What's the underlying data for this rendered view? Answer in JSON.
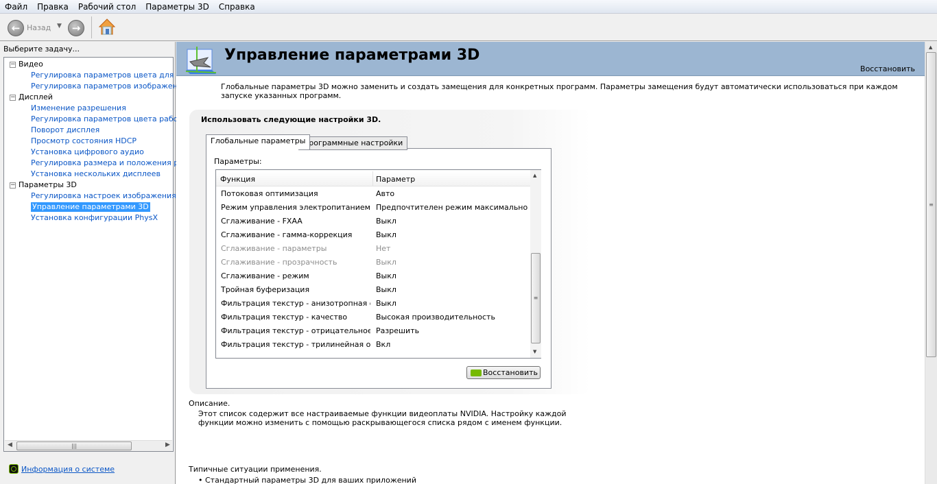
{
  "menu": [
    "Файл",
    "Правка",
    "Рабочий стол",
    "Параметры 3D",
    "Справка"
  ],
  "toolbar": {
    "back_label": "Назад"
  },
  "left": {
    "heading": "Выберите задачу...",
    "tree": [
      {
        "label": "Видео",
        "level": 0
      },
      {
        "label": "Регулировка параметров цвета для вид",
        "level": 1
      },
      {
        "label": "Регулировка параметров изображения д",
        "level": 1
      },
      {
        "label": "Дисплей",
        "level": 0
      },
      {
        "label": "Изменение разрешения",
        "level": 1
      },
      {
        "label": "Регулировка параметров цвета рабочег",
        "level": 1
      },
      {
        "label": "Поворот дисплея",
        "level": 1
      },
      {
        "label": "Просмотр состояния HDCP",
        "level": 1
      },
      {
        "label": "Установка цифрового аудио",
        "level": 1
      },
      {
        "label": "Регулировка размера и положения рабо",
        "level": 1
      },
      {
        "label": "Установка нескольких дисплеев",
        "level": 1
      },
      {
        "label": "Параметры 3D",
        "level": 0
      },
      {
        "label": "Регулировка настроек изображения с пр",
        "level": 1
      },
      {
        "label": "Управление параметрами 3D",
        "level": 1,
        "selected": true
      },
      {
        "label": "Установка конфигурации PhysX",
        "level": 1
      }
    ],
    "system_info": "Информация о системе"
  },
  "main": {
    "title": "Управление параметрами 3D",
    "restore_link": "Восстановить",
    "intro": "Глобальные параметры 3D можно заменить и создать замещения для конкретных программ. Параметры замещения будут автоматически использоваться при каждом запуске указанных программ.",
    "section_title": "Использовать следующие настройки 3D.",
    "tabs": [
      {
        "label": "Глобальные параметры",
        "active": true
      },
      {
        "label": "Программные настройки",
        "active": false
      }
    ],
    "params_label": "Параметры:",
    "columns": [
      "Функция",
      "Параметр"
    ],
    "rows": [
      {
        "f": "Потоковая оптимизация",
        "v": "Авто"
      },
      {
        "f": "Режим управления электропитанием",
        "v": "Предпочтителен режим максимальной п..."
      },
      {
        "f": "Сглаживание - FXAA",
        "v": "Выкл"
      },
      {
        "f": "Сглаживание - гамма-коррекция",
        "v": "Выкл"
      },
      {
        "f": "Сглаживание - параметры",
        "v": "Нет",
        "disabled": true
      },
      {
        "f": "Сглаживание - прозрачность",
        "v": "Выкл",
        "disabled": true
      },
      {
        "f": "Сглаживание - режим",
        "v": "Выкл"
      },
      {
        "f": "Тройная буферизация",
        "v": "Выкл"
      },
      {
        "f": "Фильтрация текстур - анизотропная оп...",
        "v": "Выкл"
      },
      {
        "f": "Фильтрация текстур - качество",
        "v": "Высокая производительность"
      },
      {
        "f": "Фильтрация текстур - отрицательное о...",
        "v": "Разрешить"
      },
      {
        "f": "Фильтрация текстур - трилинейная опт...",
        "v": "Вкл"
      }
    ],
    "restore_button": "Восстановить",
    "description_title": "Описание.",
    "description": "Этот список содержит все настраиваемые функции видеоплаты NVIDIA. Настройку каждой функции можно изменить с помощью раскрывающегося списка рядом с именем функции.",
    "usage_title": "Типичные ситуации применения.",
    "usage_items": [
      "Стандартный параметры 3D для ваших приложений"
    ]
  },
  "colors": {
    "banner": "#9cb6d2",
    "link": "#0a56c6",
    "selection": "#3399ff",
    "nvidia_green": "#76b900"
  }
}
